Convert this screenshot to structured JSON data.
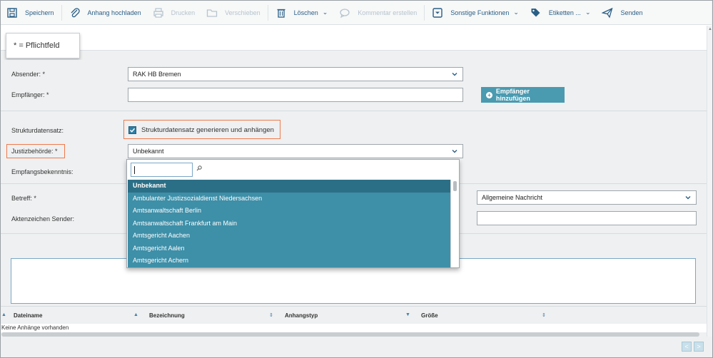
{
  "toolbar": {
    "items": [
      {
        "label": "Speichern",
        "icon": "save-icon",
        "enabled": true
      },
      {
        "label": "Anhang hochladen",
        "icon": "paperclip-icon",
        "enabled": true
      },
      {
        "label": "Drucken",
        "icon": "printer-icon",
        "enabled": false
      },
      {
        "label": "Verschieben",
        "icon": "folder-icon",
        "enabled": false
      },
      {
        "label": "Löschen",
        "icon": "trash-icon",
        "enabled": true
      },
      {
        "label": "Kommentar erstellen",
        "icon": "comment-icon",
        "enabled": false
      },
      {
        "label": "Sonstige Funktionen",
        "icon": "dropdown-box-icon",
        "enabled": true
      },
      {
        "label": "Etiketten ...",
        "icon": "tags-icon",
        "enabled": true
      },
      {
        "label": "Senden",
        "icon": "send-icon",
        "enabled": true
      }
    ]
  },
  "required_note": "* = Pflichtfeld",
  "form": {
    "absender_label": "Absender: *",
    "absender_value": "RAK HB Bremen",
    "empfaenger_label": "Empfänger: *",
    "empfaenger_value": "",
    "add_recipient_label": "Empfänger hinzufügen",
    "strukturdatensatz_label": "Strukturdatensatz:",
    "strukturdatensatz_checkbox_label": "Strukturdatensatz generieren und anhängen",
    "strukturdatensatz_checked": true,
    "justizbehoerde_label": "Justizbehörde: *",
    "justizbehoerde_value": "Unbekannt",
    "empfangsbekenntnis_label": "Empfangsbekenntnis:",
    "betreff_label": "Betreff: *",
    "nachrichtentyp_value": "Allgemeine Nachricht",
    "aktenzeichen_label": "Aktenzeichen Sender:",
    "aktenzeichen_value": ""
  },
  "dropdown": {
    "search_value": "",
    "options": [
      "Unbekannt",
      "Ambulanter Justizsozialdienst Niedersachsen",
      "Amtsanwaltschaft Berlin",
      "Amtsanwaltschaft Frankfurt am Main",
      "Amtsgericht Aachen",
      "Amtsgericht Aalen",
      "Amtsgericht Achern"
    ],
    "selected": "Unbekannt"
  },
  "attachments": {
    "columns": [
      "Dateiname",
      "Bezeichnung",
      "Anhangstyp",
      "Größe"
    ],
    "empty_text": "Keine Anhänge vorhanden"
  },
  "pagination": {
    "prev": "<",
    "next": ">"
  },
  "colors": {
    "accent": "#4a9ab0",
    "highlight": "#f07a4b",
    "dropdown_bg": "#3e8fa8"
  }
}
